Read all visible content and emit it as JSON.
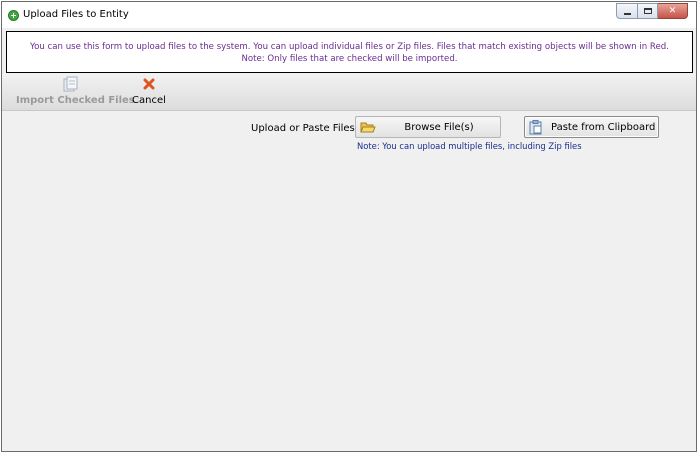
{
  "window": {
    "title": "Upload Files to Entity",
    "icon": "add-circle-icon",
    "controls": [
      "minimize-icon",
      "maximize-icon",
      "close-icon"
    ]
  },
  "info": {
    "line1": "You can use this form to upload files to the system. You can upload individual files or Zip files. Files that match existing objects will be shown in Red.",
    "line2": "Note: Only files that are checked will be imported.",
    "color": "#6b2b91"
  },
  "toolbar": {
    "import_label": "Import Checked Files",
    "import_disabled": true,
    "cancel_label": "Cancel"
  },
  "upload": {
    "label": "Upload or Paste Files:",
    "browse_label": "Browse File(s)",
    "paste_label": "Paste from Clipboard",
    "note": "Note: You can upload multiple files, including Zip files",
    "note_color": "#1c2d8c"
  }
}
